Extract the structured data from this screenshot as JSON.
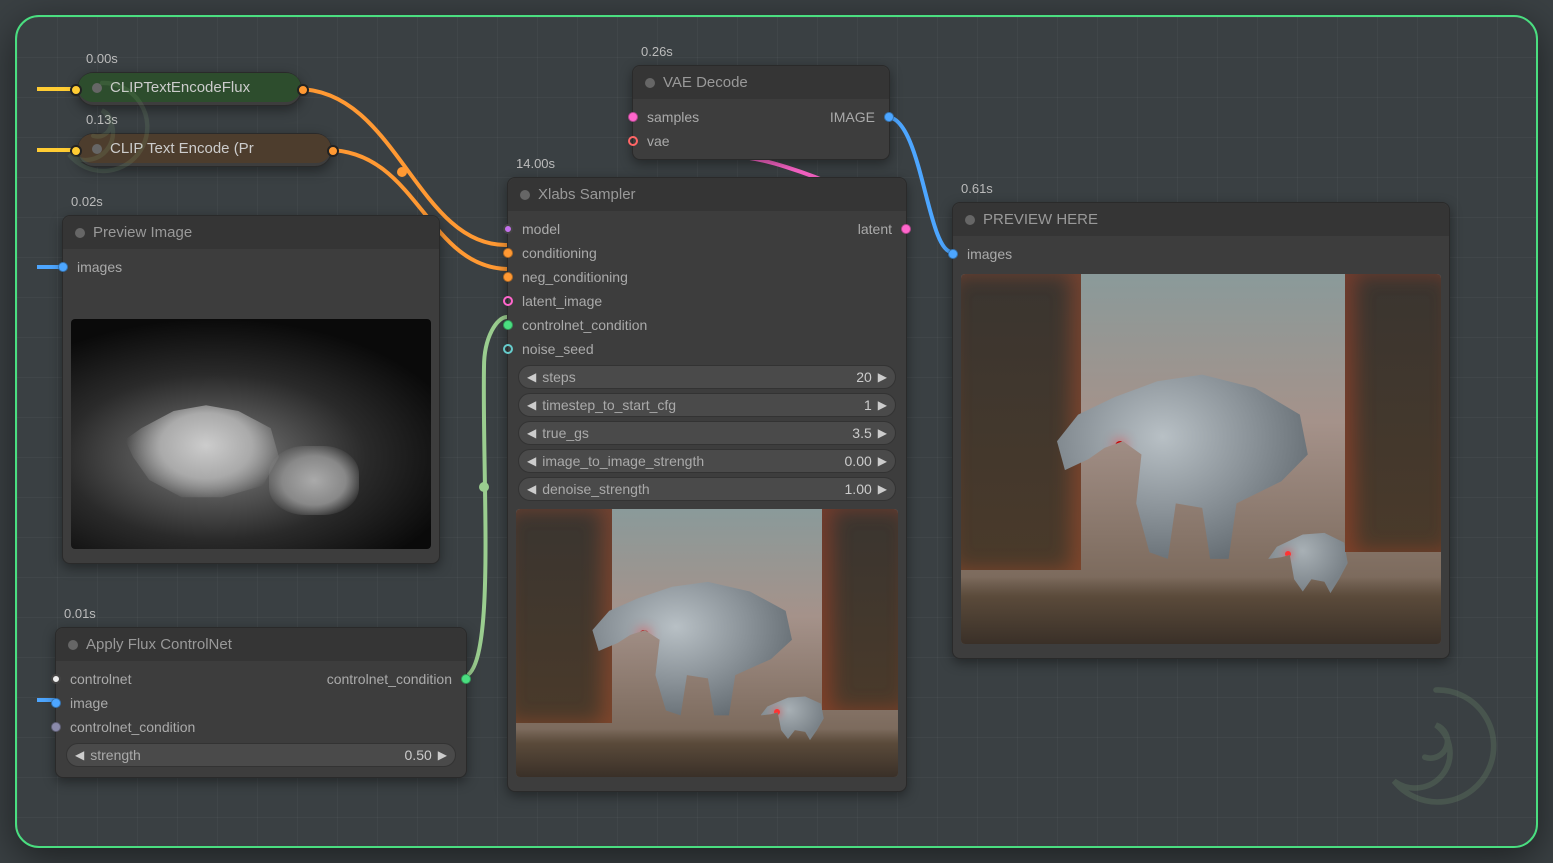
{
  "nodes": {
    "clip_flux": {
      "time": "0.00s",
      "title": "CLIPTextEncodeFlux"
    },
    "clip_pr": {
      "time": "0.13s",
      "title": "CLIP Text Encode (Pr"
    },
    "preview": {
      "time": "0.02s",
      "title": "Preview Image",
      "inputs": {
        "images": "images"
      }
    },
    "apply_controlnet": {
      "time": "0.01s",
      "title": "Apply Flux ControlNet",
      "inputs": {
        "controlnet": "controlnet",
        "image": "image",
        "controlnet_condition": "controlnet_condition"
      },
      "outputs": {
        "controlnet_condition": "controlnet_condition"
      },
      "widgets": {
        "strength": {
          "label": "strength",
          "value": "0.50"
        }
      }
    },
    "sampler": {
      "time": "14.00s",
      "title": "Xlabs Sampler",
      "inputs": {
        "model": "model",
        "conditioning": "conditioning",
        "neg_conditioning": "neg_conditioning",
        "latent_image": "latent_image",
        "controlnet_condition": "controlnet_condition",
        "noise_seed": "noise_seed"
      },
      "outputs": {
        "latent": "latent"
      },
      "widgets": {
        "steps": {
          "label": "steps",
          "value": "20"
        },
        "timestep_to_start_cfg": {
          "label": "timestep_to_start_cfg",
          "value": "1"
        },
        "true_gs": {
          "label": "true_gs",
          "value": "3.5"
        },
        "image_to_image_strength": {
          "label": "image_to_image_strength",
          "value": "0.00"
        },
        "denoise_strength": {
          "label": "denoise_strength",
          "value": "1.00"
        }
      }
    },
    "vae_decode": {
      "time": "0.26s",
      "title": "VAE Decode",
      "inputs": {
        "samples": "samples",
        "vae": "vae"
      },
      "outputs": {
        "image": "IMAGE"
      }
    },
    "preview_here": {
      "time": "0.61s",
      "title": "PREVIEW HERE",
      "inputs": {
        "images": "images"
      }
    }
  },
  "colors": {
    "orange": "#ff9933",
    "pink": "#ff66cc",
    "blue": "#4da6ff",
    "green": "#4ade80",
    "purple": "#c471ed"
  }
}
